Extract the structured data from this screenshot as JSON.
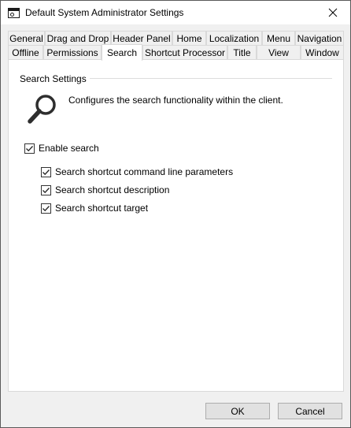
{
  "window": {
    "title": "Default System Administrator Settings",
    "close_symbol": "✕"
  },
  "tabs": {
    "row1": [
      "General",
      "Drag and Drop",
      "Header Panel",
      "Home",
      "Localization",
      "Menu",
      "Navigation"
    ],
    "row2": [
      "Offline",
      "Permissions",
      "Search",
      "Shortcut Processor",
      "Title",
      "View",
      "Window"
    ],
    "active": "Search"
  },
  "panel": {
    "group_title": "Search Settings",
    "icon": "search-icon",
    "description": "Configures the search functionality within the client.",
    "enable_search": {
      "label": "Enable search",
      "checked": true
    },
    "options": [
      {
        "label": "Search shortcut command line parameters",
        "checked": true
      },
      {
        "label": "Search shortcut description",
        "checked": true
      },
      {
        "label": "Search shortcut target",
        "checked": true
      }
    ]
  },
  "buttons": {
    "ok": "OK",
    "cancel": "Cancel"
  }
}
